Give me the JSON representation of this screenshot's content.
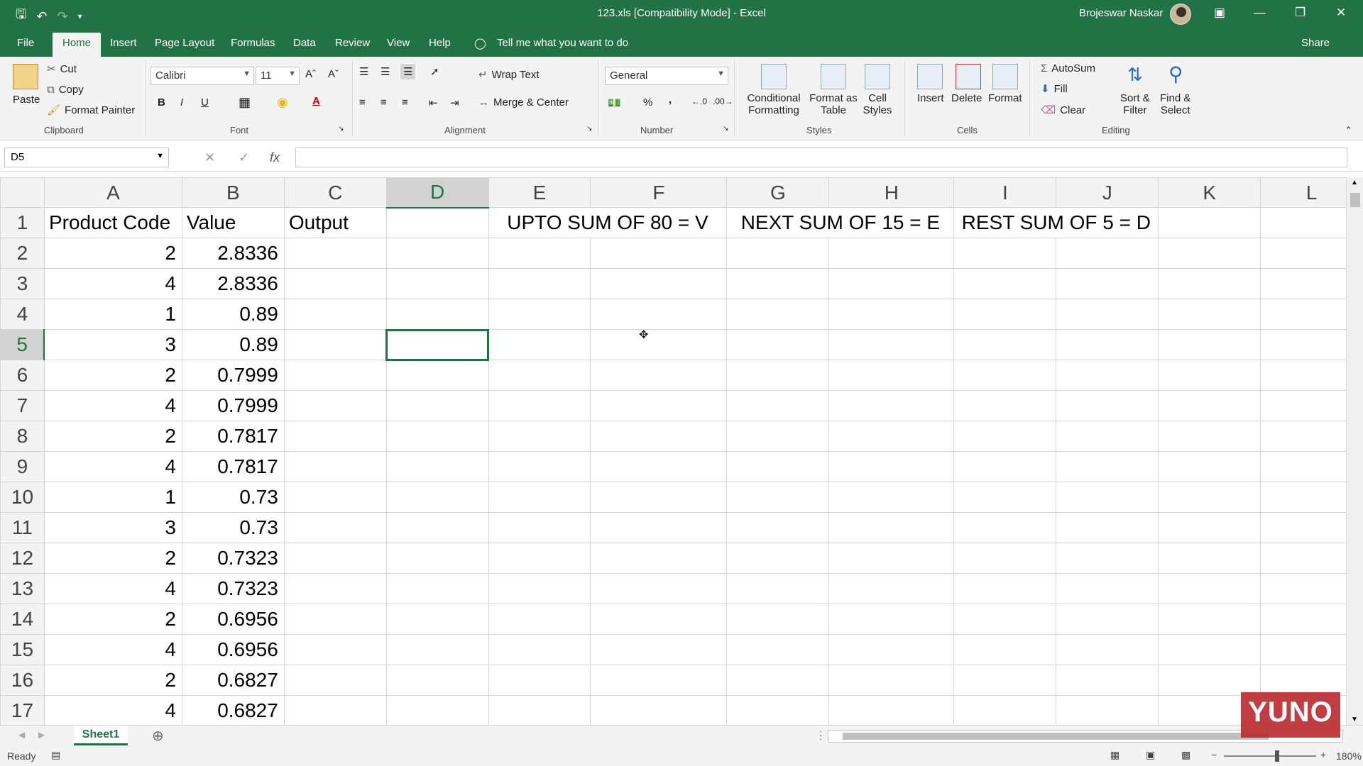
{
  "window": {
    "title": "123.xls  [Compatibility Mode]  -  Excel",
    "user": "Brojeswar Naskar",
    "share": "Share"
  },
  "tabs": [
    "File",
    "Home",
    "Insert",
    "Page Layout",
    "Formulas",
    "Data",
    "Review",
    "View",
    "Help"
  ],
  "tellme": "Tell me what you want to do",
  "ribbon": {
    "clipboard": {
      "paste": "Paste",
      "cut": "Cut",
      "copy": "Copy",
      "format_painter": "Format Painter",
      "label": "Clipboard"
    },
    "font": {
      "name": "Calibri",
      "size": "11",
      "bold": "B",
      "italic": "I",
      "underline": "U",
      "label": "Font"
    },
    "alignment": {
      "wrap": "Wrap Text",
      "merge": "Merge & Center",
      "label": "Alignment"
    },
    "number": {
      "format": "General",
      "percent": "%",
      "comma": ",",
      "label": "Number"
    },
    "styles": {
      "conditional_1": "Conditional",
      "conditional_2": "Formatting",
      "format_table_1": "Format as",
      "format_table_2": "Table",
      "cell_styles_1": "Cell",
      "cell_styles_2": "Styles",
      "label": "Styles"
    },
    "cells": {
      "insert": "Insert",
      "delete": "Delete",
      "format": "Format",
      "label": "Cells"
    },
    "editing": {
      "autosum": "AutoSum",
      "fill": "Fill",
      "clear": "Clear",
      "sort_1": "Sort &",
      "sort_2": "Filter",
      "find_1": "Find &",
      "find_2": "Select",
      "label": "Editing"
    }
  },
  "formula_bar": {
    "name_box": "D5",
    "fx": "fx",
    "value": ""
  },
  "columns": [
    "A",
    "B",
    "C",
    "D",
    "E",
    "F",
    "G",
    "H",
    "I",
    "J",
    "K",
    "L"
  ],
  "header_row": {
    "a": "Product Code",
    "b": "Value",
    "c": "Output",
    "ef": "UPTO SUM OF 80  = V",
    "gh": "NEXT SUM OF 15 = E",
    "ij": "REST SUM OF 5 = D"
  },
  "rows": [
    {
      "n": "1"
    },
    {
      "n": "2",
      "a": "2",
      "b": "2.8336"
    },
    {
      "n": "3",
      "a": "4",
      "b": "2.8336"
    },
    {
      "n": "4",
      "a": "1",
      "b": "0.89"
    },
    {
      "n": "5",
      "a": "3",
      "b": "0.89"
    },
    {
      "n": "6",
      "a": "2",
      "b": "0.7999"
    },
    {
      "n": "7",
      "a": "4",
      "b": "0.7999"
    },
    {
      "n": "8",
      "a": "2",
      "b": "0.7817"
    },
    {
      "n": "9",
      "a": "4",
      "b": "0.7817"
    },
    {
      "n": "10",
      "a": "1",
      "b": "0.73"
    },
    {
      "n": "11",
      "a": "3",
      "b": "0.73"
    },
    {
      "n": "12",
      "a": "2",
      "b": "0.7323"
    },
    {
      "n": "13",
      "a": "4",
      "b": "0.7323"
    },
    {
      "n": "14",
      "a": "2",
      "b": "0.6956"
    },
    {
      "n": "15",
      "a": "4",
      "b": "0.6956"
    },
    {
      "n": "16",
      "a": "2",
      "b": "0.6827"
    },
    {
      "n": "17",
      "a": "4",
      "b": "0.6827"
    }
  ],
  "active_cell": {
    "column": "D",
    "row": "5"
  },
  "sheet_tab": "Sheet1",
  "status": {
    "ready": "Ready",
    "zoom": "180%"
  },
  "watermark": "YUNO"
}
